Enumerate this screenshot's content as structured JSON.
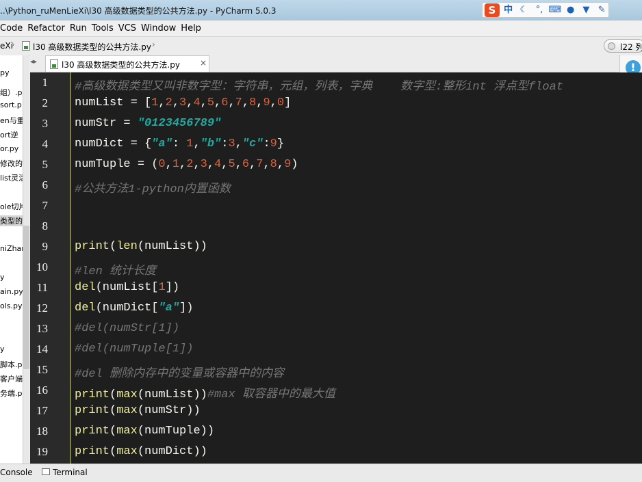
{
  "window": {
    "title": "..\\Python_ruMenLieXi\\l30 高级数据类型的公共方法.py - PyCharm 5.0.3",
    "ime_logo": "S",
    "ime_mode": "中",
    "ime_icons": [
      "moon-icon",
      "punctuation-icon",
      "keyboard-icon",
      "user-icon",
      "shirt-icon",
      "wrench-icon"
    ]
  },
  "menu": [
    "Code",
    "Refactor",
    "Run",
    "Tools",
    "VCS",
    "Window",
    "Help"
  ],
  "navbar": {
    "crumb1": "eXi",
    "crumb2": "l30 高级数据类型的公共方法.py",
    "run_config": "l22 列"
  },
  "project_items": [
    {
      "label": "py",
      "selected": false
    },
    {
      "label": "组）.p",
      "selected": false
    },
    {
      "label": "sort.p",
      "selected": false
    },
    {
      "label": "en与重",
      "selected": false
    },
    {
      "label": "ort逆",
      "selected": false
    },
    {
      "label": "or.py",
      "selected": false
    },
    {
      "label": "修改的",
      "selected": false
    },
    {
      "label": "list灵活",
      "selected": false
    },
    {
      "label": "ole切片",
      "selected": false
    },
    {
      "label": "类型的",
      "selected": true
    },
    {
      "label": "niZhan",
      "selected": false
    },
    {
      "label": "y",
      "selected": false
    },
    {
      "label": "ain.py",
      "selected": false
    },
    {
      "label": "ols.py",
      "selected": false
    },
    {
      "label": "y",
      "selected": false
    },
    {
      "label": "脚本.py",
      "selected": false
    },
    {
      "label": "客户端.",
      "selected": false
    },
    {
      "label": "务端.p",
      "selected": false
    }
  ],
  "tab": {
    "label": "l30 高级数据类型的公共方法.py",
    "close": "×"
  },
  "notification": "!",
  "editor": {
    "line_numbers": [
      "1",
      "2",
      "3",
      "4",
      "5",
      "6",
      "7",
      "8",
      "9",
      "10",
      "11",
      "12",
      "13",
      "14",
      "15",
      "16",
      "17",
      "18",
      "19"
    ],
    "lines": [
      [
        {
          "t": "#高级数据类型又叫非数字型：字符串，元组，列表，字典    数字型:整形int 浮点型float",
          "c": "cmt"
        }
      ],
      [
        {
          "t": "numList = [",
          "c": "pun"
        },
        {
          "t": "1",
          "c": "num"
        },
        {
          "t": ",",
          "c": "pun"
        },
        {
          "t": "2",
          "c": "num"
        },
        {
          "t": ",",
          "c": "pun"
        },
        {
          "t": "3",
          "c": "num"
        },
        {
          "t": ",",
          "c": "pun"
        },
        {
          "t": "4",
          "c": "num"
        },
        {
          "t": ",",
          "c": "pun"
        },
        {
          "t": "5",
          "c": "num"
        },
        {
          "t": ",",
          "c": "pun"
        },
        {
          "t": "6",
          "c": "num"
        },
        {
          "t": ",",
          "c": "pun"
        },
        {
          "t": "7",
          "c": "num"
        },
        {
          "t": ",",
          "c": "pun"
        },
        {
          "t": "8",
          "c": "num"
        },
        {
          "t": ",",
          "c": "pun"
        },
        {
          "t": "9",
          "c": "num"
        },
        {
          "t": ",",
          "c": "pun"
        },
        {
          "t": "0",
          "c": "num"
        },
        {
          "t": "]",
          "c": "pun"
        }
      ],
      [
        {
          "t": "numStr = ",
          "c": "pun"
        },
        {
          "t": "\"0123456789\"",
          "c": "str"
        }
      ],
      [
        {
          "t": "numDict = {",
          "c": "pun"
        },
        {
          "t": "\"a\"",
          "c": "str"
        },
        {
          "t": ": ",
          "c": "pun"
        },
        {
          "t": "1",
          "c": "num"
        },
        {
          "t": ",",
          "c": "pun"
        },
        {
          "t": "\"b\"",
          "c": "str"
        },
        {
          "t": ":",
          "c": "pun"
        },
        {
          "t": "3",
          "c": "num"
        },
        {
          "t": ",",
          "c": "pun"
        },
        {
          "t": "\"c\"",
          "c": "str"
        },
        {
          "t": ":",
          "c": "pun"
        },
        {
          "t": "9",
          "c": "num"
        },
        {
          "t": "}",
          "c": "pun"
        }
      ],
      [
        {
          "t": "numTuple = (",
          "c": "pun"
        },
        {
          "t": "0",
          "c": "num"
        },
        {
          "t": ",",
          "c": "pun"
        },
        {
          "t": "1",
          "c": "num"
        },
        {
          "t": ",",
          "c": "pun"
        },
        {
          "t": "2",
          "c": "num"
        },
        {
          "t": ",",
          "c": "pun"
        },
        {
          "t": "3",
          "c": "num"
        },
        {
          "t": ",",
          "c": "pun"
        },
        {
          "t": "4",
          "c": "num"
        },
        {
          "t": ",",
          "c": "pun"
        },
        {
          "t": "5",
          "c": "num"
        },
        {
          "t": ",",
          "c": "pun"
        },
        {
          "t": "6",
          "c": "num"
        },
        {
          "t": ",",
          "c": "pun"
        },
        {
          "t": "7",
          "c": "num"
        },
        {
          "t": ",",
          "c": "pun"
        },
        {
          "t": "8",
          "c": "num"
        },
        {
          "t": ",",
          "c": "pun"
        },
        {
          "t": "9",
          "c": "num"
        },
        {
          "t": ")",
          "c": "pun"
        }
      ],
      [
        {
          "t": "#公共方法1-python内置函数",
          "c": "cmt"
        }
      ],
      [],
      [],
      [
        {
          "t": "print",
          "c": "kw"
        },
        {
          "t": "(",
          "c": "pun"
        },
        {
          "t": "len",
          "c": "kw"
        },
        {
          "t": "(numList))",
          "c": "pun"
        }
      ],
      [
        {
          "t": "#len 统计长度",
          "c": "cmt"
        }
      ],
      [
        {
          "t": "del",
          "c": "kw"
        },
        {
          "t": "(numList[",
          "c": "pun"
        },
        {
          "t": "1",
          "c": "num"
        },
        {
          "t": "])",
          "c": "pun"
        }
      ],
      [
        {
          "t": "del",
          "c": "kw"
        },
        {
          "t": "(numDict[",
          "c": "pun"
        },
        {
          "t": "\"a\"",
          "c": "str"
        },
        {
          "t": "])",
          "c": "pun"
        }
      ],
      [
        {
          "t": "#del(numStr[1])",
          "c": "cmt"
        }
      ],
      [
        {
          "t": "#del(numTuple[1])",
          "c": "cmt"
        }
      ],
      [
        {
          "t": "#del 删除内存中的变量或容器中的内容",
          "c": "cmt"
        }
      ],
      [
        {
          "t": "print",
          "c": "kw"
        },
        {
          "t": "(",
          "c": "pun"
        },
        {
          "t": "max",
          "c": "kw"
        },
        {
          "t": "(numList))",
          "c": "pun"
        },
        {
          "t": "#max 取容器中的最大值",
          "c": "cmt"
        }
      ],
      [
        {
          "t": "print",
          "c": "kw"
        },
        {
          "t": "(",
          "c": "pun"
        },
        {
          "t": "max",
          "c": "kw"
        },
        {
          "t": "(numStr))",
          "c": "pun"
        }
      ],
      [
        {
          "t": "print",
          "c": "kw"
        },
        {
          "t": "(",
          "c": "pun"
        },
        {
          "t": "max",
          "c": "kw"
        },
        {
          "t": "(numTuple))",
          "c": "pun"
        }
      ],
      [
        {
          "t": "print",
          "c": "kw"
        },
        {
          "t": "(",
          "c": "pun"
        },
        {
          "t": "max",
          "c": "kw"
        },
        {
          "t": "(numDict))",
          "c": "pun"
        }
      ]
    ]
  },
  "bottom": {
    "console": "Console",
    "terminal": "Terminal"
  },
  "colors": {
    "editor_bg": "#1e1e1e",
    "keyword": "#f1f09b",
    "number": "#e0613a",
    "string": "#22a8a0",
    "comment": "#767676"
  }
}
